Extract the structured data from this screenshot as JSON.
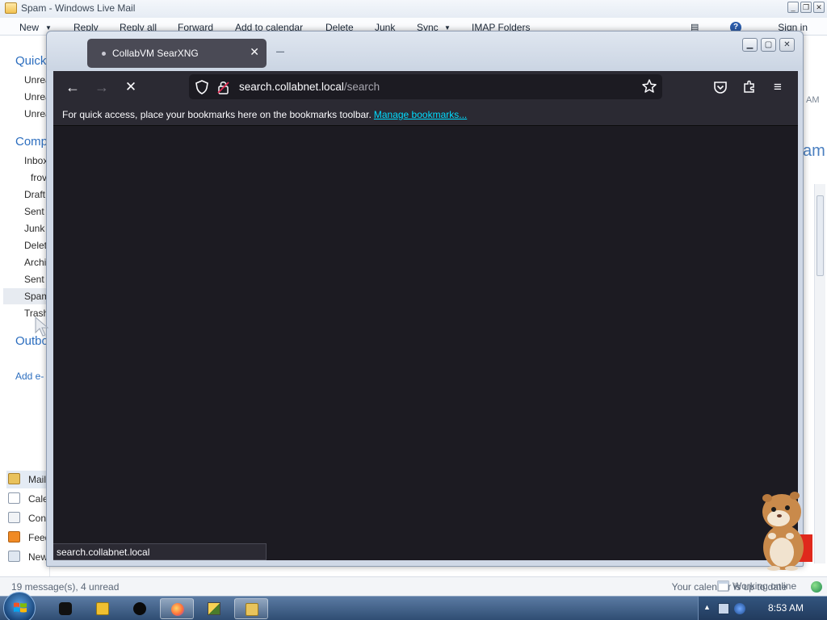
{
  "mail_window": {
    "title": "Spam - Windows Live Mail",
    "ribbon": [
      "New",
      "Reply",
      "Reply all",
      "Forward",
      "Add to calendar",
      "Delete",
      "Junk",
      "Sync",
      "IMAP Folders"
    ],
    "signin": "Sign in",
    "groups": {
      "quick": "Quick",
      "computer": "Comp",
      "outbox": "Outbo",
      "add_account": "Add e-"
    },
    "quick_views": [
      "Unrea",
      "Unrea",
      "Unrea"
    ],
    "folders": [
      "Inbox",
      "frov",
      "Draft",
      "Sent",
      "Junk",
      "Delet",
      "Archi",
      "Sent",
      "Spam",
      "Trash"
    ],
    "selected_folder_index": 8,
    "nav": [
      {
        "label": "Mail",
        "icon": "mail-icon"
      },
      {
        "label": "Cale",
        "icon": "calendar-icon"
      },
      {
        "label": "Con",
        "icon": "contacts-icon"
      },
      {
        "label": "Feed",
        "icon": "feeds-icon"
      },
      {
        "label": "New",
        "icon": "newsgroups-icon"
      }
    ],
    "right_stubs": {
      "am": "AM",
      "spam": "am"
    },
    "status_left": "19 message(s), 4 unread",
    "status_right": "Your calendar is up to date",
    "status_online": "Working online"
  },
  "browser": {
    "tab_title": "CollabVM SearXNG",
    "url_host": "search.collabnet.local",
    "url_path": "/search",
    "bookmarks_hint": "For quick access, place your bookmarks here on the bookmarks toolbar.",
    "bookmarks_link": "Manage bookmarks...",
    "status_url": "search.collabnet.local"
  },
  "taskbar": {
    "clock": "8:53 AM",
    "items": [
      "black-app-icon",
      "media-center-icon",
      "black-circle-icon",
      "firefox-icon",
      "paint-icon",
      "windows-live-mail-icon"
    ],
    "active_index": 3
  }
}
